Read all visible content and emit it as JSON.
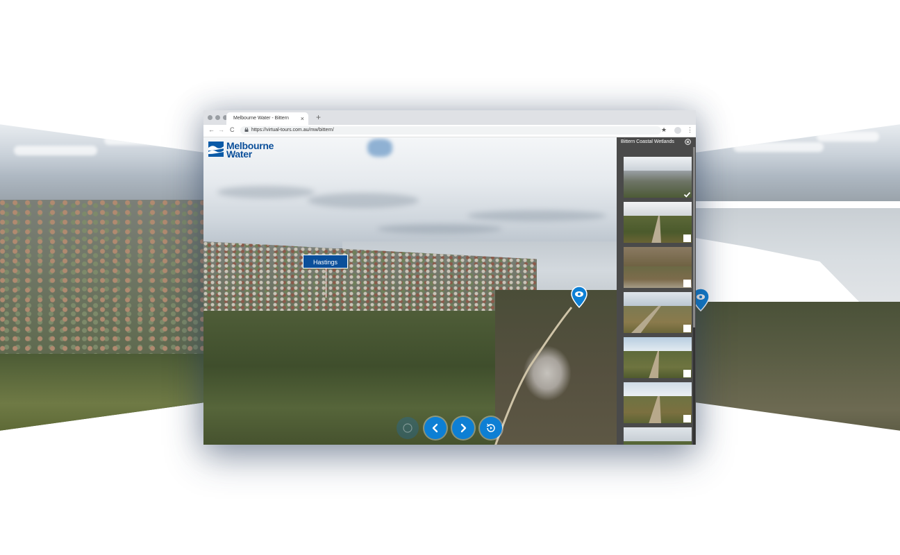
{
  "browser": {
    "tab_title": "Melbourne Water - Bittern",
    "tab_close": "×",
    "new_tab": "+",
    "url": "https://virtual-tours.com.au/mw/bittern/",
    "back": "←",
    "forward": "→",
    "reload": "C",
    "bookmark": "★",
    "menu": "⋮"
  },
  "logo": {
    "line1": "Melbourne",
    "line2": "Water"
  },
  "hotspots": {
    "place_label": "Hastings"
  },
  "panel": {
    "title": "Bittern Coastal Wetlands",
    "scenes": [
      {
        "name": "scene-1",
        "checked": true
      },
      {
        "name": "scene-2",
        "checked": false
      },
      {
        "name": "scene-3",
        "checked": false
      },
      {
        "name": "scene-4",
        "checked": false
      },
      {
        "name": "scene-5",
        "checked": false
      },
      {
        "name": "scene-6",
        "checked": false
      },
      {
        "name": "scene-7",
        "checked": false
      }
    ]
  },
  "controls": [
    "emblem-icon",
    "previous-icon",
    "next-icon",
    "autorotate-icon"
  ],
  "colors": {
    "brand_blue": "#0b4f9a",
    "control_blue": "#0d7fd4",
    "panel_bg": "#4a4a4a"
  }
}
